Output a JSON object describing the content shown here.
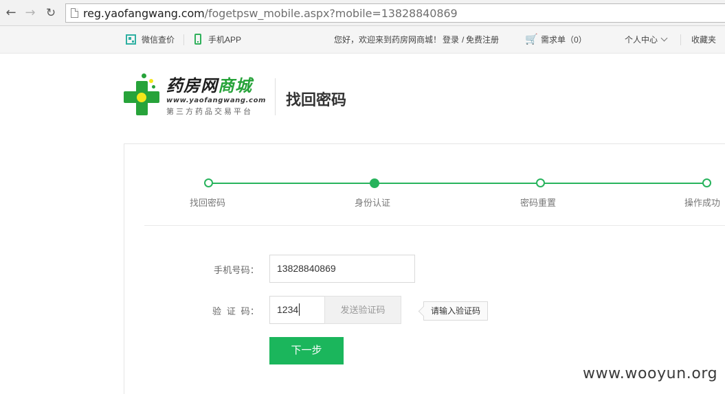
{
  "browser": {
    "url_domain": "reg.yaofangwang.com",
    "url_path": "/fogetpsw_mobile.aspx?mobile=13828840869"
  },
  "topbar": {
    "wechat_price": "微信查价",
    "mobile_app": "手机APP",
    "welcome": "您好，欢迎来到药房网商城！",
    "login": "登录",
    "separator": "/",
    "register": "免费注册",
    "demand_list": "需求单（0）",
    "personal_center": "个人中心",
    "favorites": "收藏夹"
  },
  "logo": {
    "title_black": "药房网",
    "title_green": "商城",
    "url": "www.yaofangwang.com",
    "subtitle": "第三方药品交易平台"
  },
  "page": {
    "heading": "找回密码"
  },
  "steps": [
    {
      "label": "找回密码",
      "active": false
    },
    {
      "label": "身份认证",
      "active": true
    },
    {
      "label": "密码重置",
      "active": false
    },
    {
      "label": "操作成功",
      "active": false
    }
  ],
  "form": {
    "phone_label": "手机号码：",
    "phone_value": "13828840869",
    "code_label": "验  证  码：",
    "code_value": "1234",
    "send_code": "发送验证码",
    "code_tooltip": "请输入验证码",
    "next_button": "下一步"
  },
  "watermark": "www.wooyun.org",
  "colors": {
    "accent_green": "#1bb65c",
    "logo_green": "#27a33a",
    "logo_yellow": "#f3e61b",
    "cart_red": "#d4232c"
  }
}
